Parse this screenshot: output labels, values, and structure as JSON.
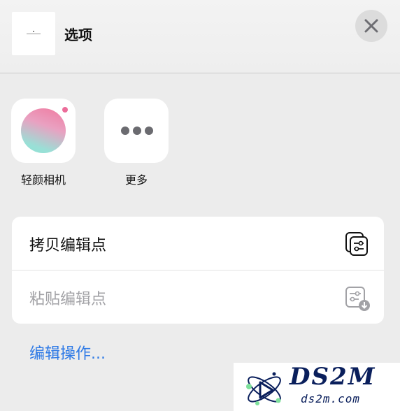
{
  "header": {
    "title": "选项",
    "close_icon": "close-icon"
  },
  "apps": [
    {
      "label": "轻颜相机",
      "icon": "camera-app-icon"
    },
    {
      "label": "更多",
      "icon": "more-dots-icon"
    }
  ],
  "actions": [
    {
      "label": "拷贝编辑点",
      "icon": "copy-edits-icon",
      "enabled": true
    },
    {
      "label": "粘贴编辑点",
      "icon": "paste-edits-icon",
      "enabled": false
    }
  ],
  "edit_actions_link": "编辑操作...",
  "colors": {
    "link": "#2f7ae6",
    "disabled_text": "#a2a2a6",
    "watermark_text": "#0a1f5c"
  },
  "watermark": {
    "brand": "DS2M",
    "url": "ds2m.com"
  }
}
